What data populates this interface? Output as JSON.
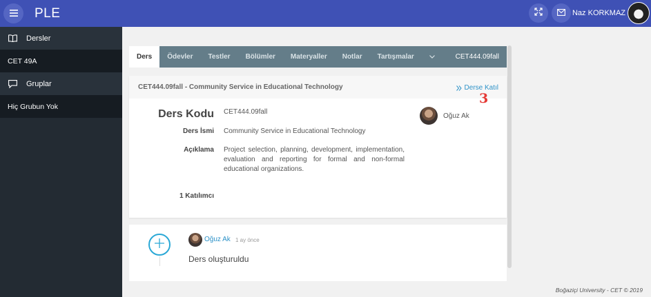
{
  "header": {
    "brand": "PLE",
    "username": "Naz KORKMAZ",
    "color": "#3f51b5"
  },
  "sidebar": {
    "items": [
      {
        "label": "Dersler",
        "icon": "book-icon"
      },
      {
        "label": "CET 49A"
      },
      {
        "label": "Gruplar",
        "icon": "chat-bubble-icon"
      },
      {
        "label": "Hiç Grubun Yok"
      }
    ]
  },
  "tabs": {
    "items": [
      "Ders",
      "Ödevler",
      "Testler",
      "Bölümler",
      "Materyaller",
      "Notlar",
      "Tartışmalar"
    ],
    "course_code": "CET444.09fall"
  },
  "course": {
    "heading": "CET444.09fall - Community Service in Educational Technology",
    "join_label": "Derse Katıl",
    "annotation": "3",
    "fields": {
      "code_label": "Ders Kodu",
      "code_value": "CET444.09fall",
      "name_label": "Ders İsmi",
      "name_value": "Community Service in Educational Technology",
      "desc_label": "Açıklama",
      "desc_value": "Project selection, planning, development, implementation, evaluation and reporting for formal and non-formal educational organizations.",
      "participants": "1 Katılımcı"
    },
    "instructor": "Oğuz Ak"
  },
  "timeline": {
    "author": "Oğuz Ak",
    "time": "1 ay önce",
    "text": "Ders oluşturuldu"
  },
  "footer": "Boğaziçi University - CET © 2019"
}
